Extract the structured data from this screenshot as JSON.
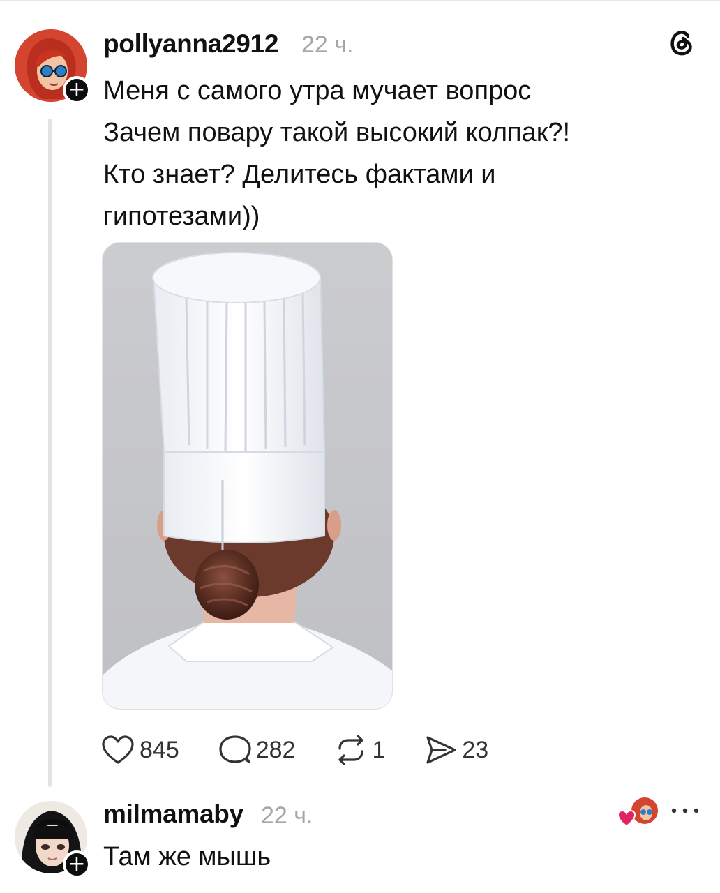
{
  "post": {
    "username": "pollyanna2912",
    "timestamp": "22 ч.",
    "text_lines": [
      "Меня с самого утра мучает вопрос",
      "Зачем повару такой высокий колпак?!",
      "Кто знает? Делитесь фактами и",
      "гипотезами))"
    ],
    "image_icon": "chef-hat-photo",
    "actions": {
      "likes": "845",
      "comments": "282",
      "reposts": "1",
      "shares": "23"
    }
  },
  "reply": {
    "username": "milmamaby",
    "timestamp": "22 ч.",
    "text": "Там же мышь",
    "liked_by_author": true
  },
  "icons": {
    "follow": "plus-icon",
    "app_logo": "threads-logo-icon",
    "like": "heart-icon",
    "comment": "comment-bubble-icon",
    "repost": "repost-icon",
    "share": "send-icon",
    "more": "more-dots-icon"
  },
  "colors": {
    "text": "#111111",
    "muted": "#a6a6a6",
    "like_red": "#e0245e",
    "thread_line": "#e3e3e3"
  }
}
